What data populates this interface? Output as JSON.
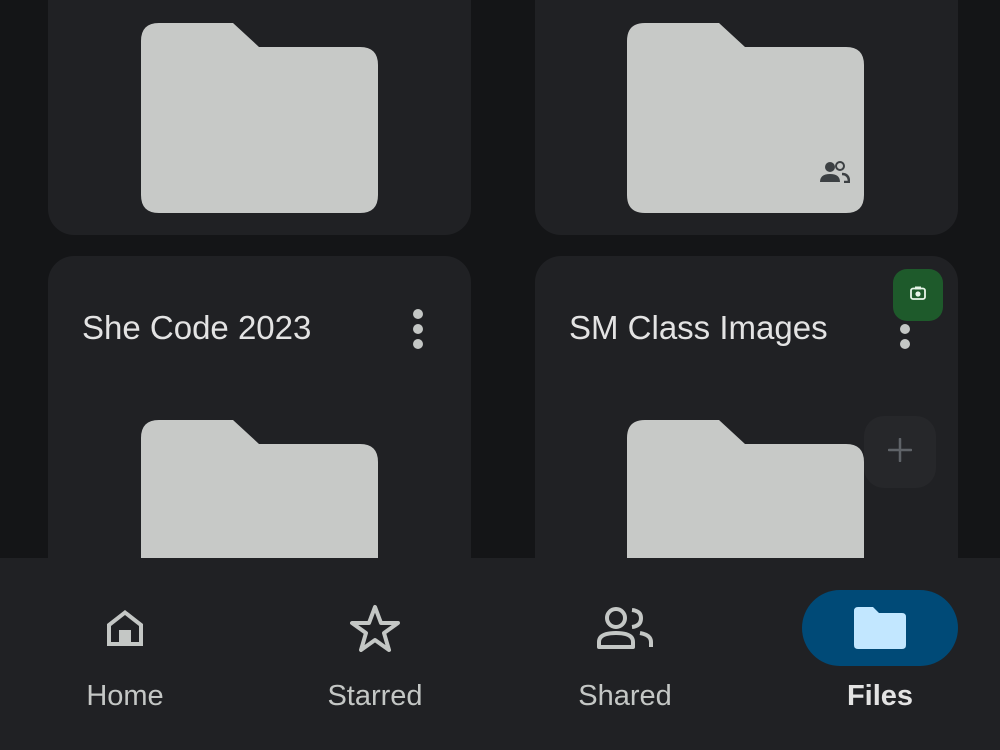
{
  "folders": [
    {
      "title": "",
      "shared": false
    },
    {
      "title": "",
      "shared": true
    },
    {
      "title": "She Code 2023",
      "shared": false
    },
    {
      "title": "SM Class Images",
      "shared": false
    }
  ],
  "colors": {
    "background": "#141517",
    "card": "#202124",
    "folder": "#c7c9c7",
    "nav_active_pill": "#004a77",
    "nav_active_icon": "#c2e7ff",
    "fab_scan": "#1e5a2b"
  },
  "fab": {
    "scan_icon": "camera-icon",
    "add_icon": "plus-icon"
  },
  "bottom_nav": {
    "items": [
      {
        "label": "Home",
        "icon": "home-icon",
        "active": false
      },
      {
        "label": "Starred",
        "icon": "star-icon",
        "active": false
      },
      {
        "label": "Shared",
        "icon": "people-icon",
        "active": false
      },
      {
        "label": "Files",
        "icon": "folder-icon",
        "active": true
      }
    ]
  }
}
